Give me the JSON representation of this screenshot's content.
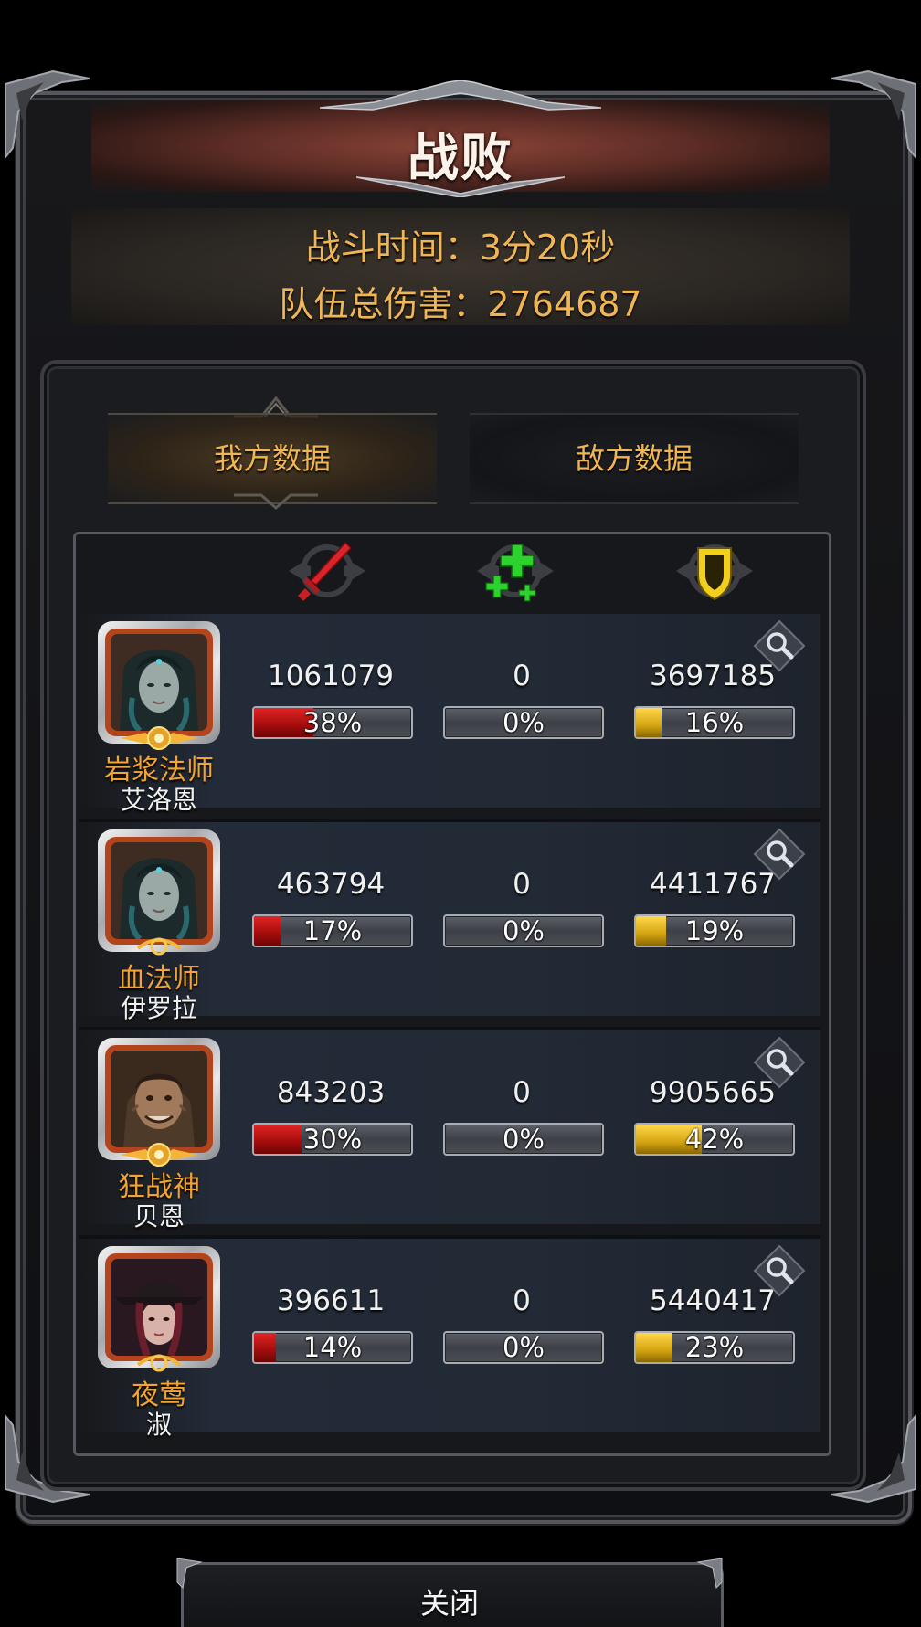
{
  "title": "战败",
  "stats": {
    "battle_time": "战斗时间：3分20秒",
    "team_damage": "队伍总伤害：2764687"
  },
  "tabs": [
    {
      "label": "我方数据",
      "active": true
    },
    {
      "label": "敌方数据",
      "active": false
    }
  ],
  "columns": [
    {
      "icon": "sword-icon",
      "color": "#e0262b"
    },
    {
      "icon": "heal-plus-icon",
      "color": "#2ecf2e"
    },
    {
      "icon": "shield-icon",
      "color": "#f4d21e"
    }
  ],
  "heroes": [
    {
      "class": "岩浆法师",
      "name": "艾洛恩",
      "damage": "1061079",
      "damage_pct": "38%",
      "damage_frac": 0.38,
      "heal": "0",
      "heal_pct": "0%",
      "heal_frac": 0,
      "tank": "3697185",
      "tank_pct": "16%",
      "tank_frac": 0.16,
      "portrait": "hooded-mage-portrait"
    },
    {
      "class": "血法师",
      "name": "伊罗拉",
      "damage": "463794",
      "damage_pct": "17%",
      "damage_frac": 0.17,
      "heal": "0",
      "heal_pct": "0%",
      "heal_frac": 0,
      "tank": "4411767",
      "tank_pct": "19%",
      "tank_frac": 0.19,
      "portrait": "hooded-mage-portrait"
    },
    {
      "class": "狂战神",
      "name": "贝恩",
      "damage": "843203",
      "damage_pct": "30%",
      "damage_frac": 0.3,
      "heal": "0",
      "heal_pct": "0%",
      "heal_frac": 0,
      "tank": "9905665",
      "tank_pct": "42%",
      "tank_frac": 0.42,
      "portrait": "berserker-portrait"
    },
    {
      "class": "夜莺",
      "name": "淑",
      "damage": "396611",
      "damage_pct": "14%",
      "damage_frac": 0.14,
      "heal": "0",
      "heal_pct": "0%",
      "heal_frac": 0,
      "tank": "5440417",
      "tank_pct": "23%",
      "tank_frac": 0.23,
      "portrait": "hatted-girl-portrait"
    }
  ],
  "close_label": "关闭"
}
